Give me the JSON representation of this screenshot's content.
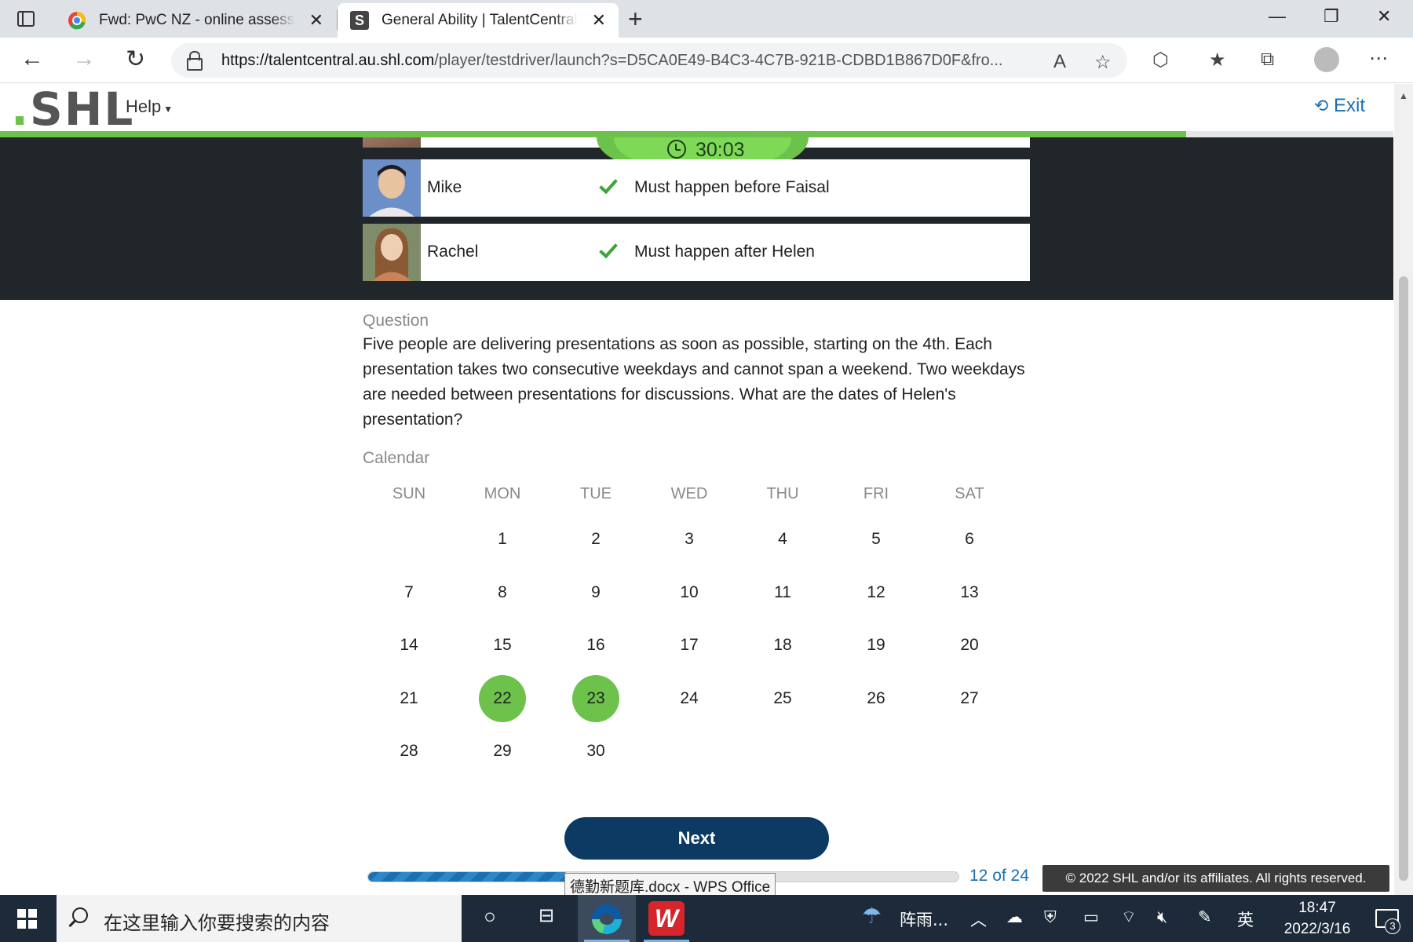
{
  "browser": {
    "tabs": [
      {
        "title": "Fwd: PwC NZ - online assessmen",
        "favicon": "chrome-mail-favicon"
      },
      {
        "title": "General Ability | TalentCentral-Ca",
        "favicon": "shl-favicon",
        "favicon_letter": "S"
      }
    ],
    "new_tab_glyph": "+",
    "url_host": "https://talentcentral.au.shl.com",
    "url_path": "/player/testdriver/launch?s=D5CA0E49-B4C3-4C7B-921B-CDBD1B867D0F&fro...",
    "read_aloud_label": "A",
    "window_controls": {
      "minimize": "—",
      "restore": "❐",
      "close": "✕"
    }
  },
  "app": {
    "logo_text": "SHL",
    "logo_dot": ".",
    "help_label": "Help",
    "exit_label": "Exit",
    "accent_color": "#6cc24a",
    "dark_color": "#0d3a63"
  },
  "timer": {
    "time": "30:03"
  },
  "people": [
    {
      "name": "Mike",
      "rule": "Must happen before Faisal"
    },
    {
      "name": "Rachel",
      "rule": "Must happen after Helen"
    }
  ],
  "question": {
    "label": "Question",
    "text": "Five people are delivering presentations as soon as possible, starting on the 4th. Each presentation takes two consecutive weekdays and cannot span a weekend. Two weekdays are needed between presentations for discussions. What are the dates of Helen's presentation?"
  },
  "calendar": {
    "label": "Calendar",
    "weekdays": [
      "SUN",
      "MON",
      "TUE",
      "WED",
      "THU",
      "FRI",
      "SAT"
    ],
    "first_weekday_index": 1,
    "days_in_month": 30,
    "selected": [
      22,
      23
    ]
  },
  "actions": {
    "next_label": "Next"
  },
  "progress": {
    "current": 12,
    "total": 24,
    "label": "12 of 24",
    "fraction": 0.34
  },
  "footer": {
    "copyright": "© 2022 SHL and/or its affiliates. All rights reserved."
  },
  "tooltip": {
    "text": "德勤新题库.docx - WPS Office"
  },
  "taskbar": {
    "search_placeholder": "在这里输入你要搜索的内容",
    "weather_text": "阵雨...",
    "ime_label": "英",
    "time": "18:47",
    "date": "2022/3/16",
    "notification_count": "3"
  }
}
